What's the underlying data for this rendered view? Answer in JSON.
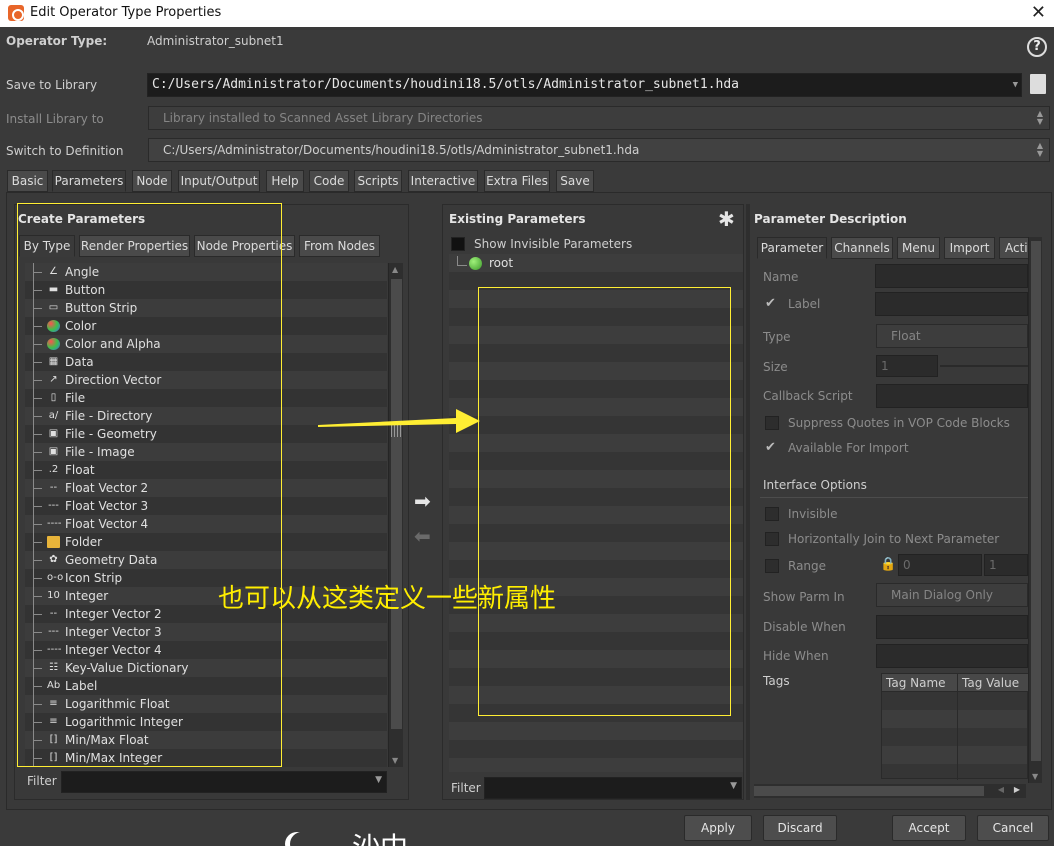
{
  "window": {
    "title": "Edit Operator Type Properties",
    "close_glyph": "✕"
  },
  "header": {
    "operator_type_label": "Operator Type:",
    "operator_type_value": "Administrator_subnet1",
    "help_glyph": "?",
    "save_to_library_label": "Save to Library",
    "save_to_library_value": "C:/Users/Administrator/Documents/houdini18.5/otls/Administrator_subnet1.hda",
    "install_library_label": "Install Library to",
    "install_library_value": "Library installed to Scanned Asset Library Directories",
    "switch_definition_label": "Switch to Definition",
    "switch_definition_value": "C:/Users/Administrator/Documents/houdini18.5/otls/Administrator_subnet1.hda"
  },
  "main_tabs": [
    "Basic",
    "Parameters",
    "Node",
    "Input/Output",
    "Help",
    "Code",
    "Scripts",
    "Interactive",
    "Extra Files",
    "Save"
  ],
  "create_parameters": {
    "title": "Create Parameters",
    "tabs": [
      "By Type",
      "Render Properties",
      "Node Properties",
      "From Nodes"
    ],
    "items": [
      {
        "label": "Angle",
        "icon": "∠"
      },
      {
        "label": "Button",
        "icon": "▬"
      },
      {
        "label": "Button Strip",
        "icon": "▭"
      },
      {
        "label": "Color",
        "icon": "●"
      },
      {
        "label": "Color and Alpha",
        "icon": "●"
      },
      {
        "label": "Data",
        "icon": "▦"
      },
      {
        "label": "Direction Vector",
        "icon": "↗"
      },
      {
        "label": "File",
        "icon": "▯"
      },
      {
        "label": "File - Directory",
        "icon": "a/"
      },
      {
        "label": "File - Geometry",
        "icon": "▣"
      },
      {
        "label": "File - Image",
        "icon": "▣"
      },
      {
        "label": "Float",
        "icon": ".2"
      },
      {
        "label": "Float Vector 2",
        "icon": "--"
      },
      {
        "label": "Float Vector 3",
        "icon": "---"
      },
      {
        "label": "Float Vector 4",
        "icon": "----"
      },
      {
        "label": "Folder",
        "icon": "▬"
      },
      {
        "label": "Geometry Data",
        "icon": "✿"
      },
      {
        "label": "Icon Strip",
        "icon": "o-o"
      },
      {
        "label": "Integer",
        "icon": "10"
      },
      {
        "label": "Integer Vector 2",
        "icon": "--"
      },
      {
        "label": "Integer Vector 3",
        "icon": "---"
      },
      {
        "label": "Integer Vector 4",
        "icon": "----"
      },
      {
        "label": "Key-Value Dictionary",
        "icon": "☷"
      },
      {
        "label": "Label",
        "icon": "Ab"
      },
      {
        "label": "Logarithmic Float",
        "icon": "≡"
      },
      {
        "label": "Logarithmic Integer",
        "icon": "≡"
      },
      {
        "label": "Min/Max Float",
        "icon": "[]"
      },
      {
        "label": "Min/Max Integer",
        "icon": "[]"
      }
    ],
    "filter_label": "Filter"
  },
  "existing_parameters": {
    "title": "Existing Parameters",
    "show_invisible_label": "Show Invisible Parameters",
    "root_label": "root",
    "filter_label": "Filter"
  },
  "parameter_description": {
    "title": "Parameter Description",
    "tabs": [
      "Parameter",
      "Channels",
      "Menu",
      "Import",
      "Acti"
    ],
    "name_label": "Name",
    "label_label": "Label",
    "type_label": "Type",
    "type_value": "Float",
    "size_label": "Size",
    "size_value": "1",
    "callback_label": "Callback Script",
    "suppress_quotes_label": "Suppress Quotes in VOP Code Blocks",
    "available_import_label": "Available For Import",
    "interface_options_label": "Interface Options",
    "invisible_label": "Invisible",
    "horizontally_join_label": "Horizontally Join to Next Parameter",
    "range_label": "Range",
    "range_min": "0",
    "range_max": "1",
    "show_parm_label": "Show Parm In",
    "show_parm_value": "Main Dialog Only",
    "disable_when_label": "Disable When",
    "hide_when_label": "Hide When",
    "tags_label": "Tags",
    "tag_columns": [
      "Tag Name",
      "Tag Value"
    ]
  },
  "footer": {
    "apply": "Apply",
    "discard": "Discard",
    "accept": "Accept",
    "cancel": "Cancel"
  },
  "annotation": {
    "text": "也可以从这类定义一些新属性",
    "bottom_text": "沙中"
  },
  "colors": {
    "accent_highlight": "#ffee33",
    "annotation": "#ffee00",
    "titlebar": "#ffffff"
  }
}
